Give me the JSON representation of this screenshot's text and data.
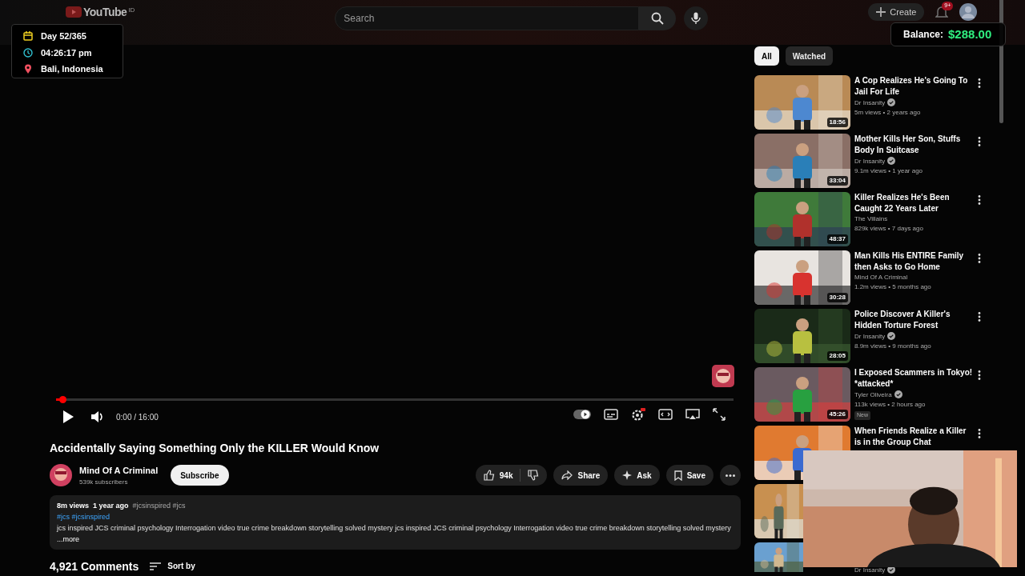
{
  "header": {
    "logo": "YouTube",
    "region": "ID",
    "search": {
      "placeholder": "Search"
    },
    "create": "Create",
    "notifications": "9+"
  },
  "player": {
    "level": 0.01,
    "time": "0:00 / 16:00",
    "playing": false
  },
  "video": {
    "title": "Accidentally Saying Something Only the KILLER Would Know",
    "channel": "Mind Of A Criminal",
    "subscribers": "539k subscribers",
    "subscribe": "Subscribe",
    "likes": "94k",
    "share": "Share",
    "ask": "Ask",
    "save": "Save"
  },
  "description": {
    "views": "8m views",
    "age": "1 year ago",
    "tags": "#jcsinspired #jcs",
    "hashtags": "#jcs #jcsinspired",
    "text": "jcs inspired JCS criminal psychology Interrogation video true crime breakdown storytelling solved mystery jcs inspired JCS criminal psychology Interrogation video true crime breakdown storytelling solved mystery",
    "more": "...more"
  },
  "comments": {
    "count": "4,921 Comments",
    "sort": "Sort by"
  },
  "filters": [
    {
      "label": "All",
      "selected": true
    },
    {
      "label": "Watched",
      "selected": false
    }
  ],
  "videos": [
    {
      "title": "A Cop Realizes He's Going To Jail For Life",
      "channel": "Dr Insanity",
      "verified": true,
      "meta": "5m views • 2 years ago",
      "duration": "18:56"
    },
    {
      "title": "Mother Kills Her Son, Stuffs Body In Suitcase",
      "channel": "Dr Insanity",
      "verified": true,
      "meta": "9.1m views • 1 year ago",
      "duration": "33:04"
    },
    {
      "title": "Killer Realizes He's Been Caught 22 Years Later",
      "channel": "The Villains",
      "verified": false,
      "meta": "829k views • 7 days ago",
      "duration": "48:37"
    },
    {
      "title": "Man Kills His ENTIRE Family then Asks to Go Home",
      "channel": "Mind Of A Criminal",
      "verified": false,
      "meta": "1.2m views • 5 months ago",
      "duration": "30:28"
    },
    {
      "title": "Police Discover A Killer's Hidden Torture Forest",
      "channel": "Dr Insanity",
      "verified": true,
      "meta": "8.9m views • 9 months ago",
      "duration": "28:05"
    },
    {
      "title": "I Exposed Scammers in Tokyo! *attacked*",
      "channel": "Tyler Oliveira",
      "verified": true,
      "meta": "113k views • 2 hours ago",
      "duration": "45:26",
      "badge": "New"
    },
    {
      "title": "When Friends Realize a Killer is in the Group Chat"
    },
    {
      "kind": "picture"
    },
    {
      "channel": "Dr Insanity",
      "verified": true
    }
  ],
  "overlay": {
    "day": "Day 52/365",
    "clock": "04:26:17 pm",
    "location": "Bali, Indonesia",
    "balance_label": "Balance:",
    "balance": "$288.00"
  }
}
